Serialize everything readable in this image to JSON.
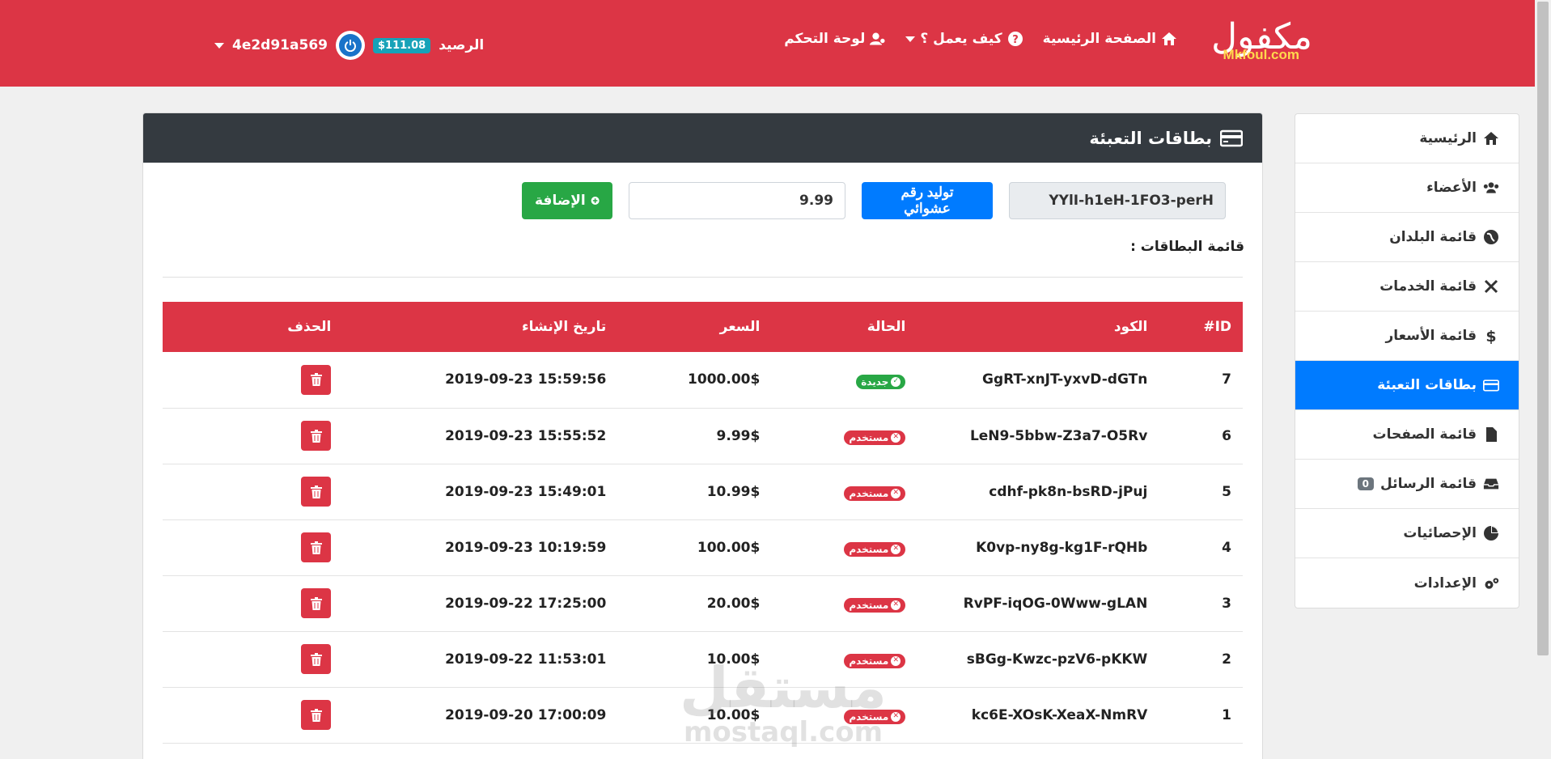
{
  "navbar": {
    "logo_ar": "مكفول",
    "logo_en": "Mkfoul.com",
    "links": {
      "home": "الصفحة الرئيسية",
      "how_it_works": "كيف يعمل ؟",
      "dashboard": "لوحة التحكم"
    },
    "balance_label": "الرصيد",
    "balance_value": "$111.08",
    "username": "4e2d91a569"
  },
  "sidebar": {
    "items": [
      {
        "label": "الرئيسية",
        "icon": "home-icon"
      },
      {
        "label": "الأعضاء",
        "icon": "users-icon"
      },
      {
        "label": "قائمة البلدان",
        "icon": "globe-icon"
      },
      {
        "label": "قائمة الخدمات",
        "icon": "tools-icon"
      },
      {
        "label": "قائمة الأسعار",
        "icon": "dollar-icon"
      },
      {
        "label": "بطاقات التعبئة",
        "icon": "credit-card-icon",
        "active": true
      },
      {
        "label": "قائمة الصفحات",
        "icon": "file-icon"
      },
      {
        "label": "قائمة الرسائل",
        "icon": "inbox-icon",
        "badge": "0"
      },
      {
        "label": "الإحصائيات",
        "icon": "pie-chart-icon"
      },
      {
        "label": "الإعدادات",
        "icon": "cogs-icon"
      }
    ]
  },
  "main": {
    "title": "بطاقات التعبئة",
    "code_value": "YYlI-h1eH-1FO3-perH",
    "generate_label": "توليد رقم عشوائي",
    "price_value": "9.99",
    "add_label": "الإضافة",
    "list_title": "قائمة البطاقات :"
  },
  "table": {
    "headers": {
      "id": "ID#",
      "code": "الكود",
      "status": "الحالة",
      "price": "السعر",
      "date": "تاريخ الإنشاء",
      "delete": "الحذف"
    },
    "rows": [
      {
        "id": "7",
        "code": "GgRT-xnJT-yxvD-dGTn",
        "status": "جديدة",
        "type": "new",
        "price": "1000.00$",
        "date": "2019-09-23 15:59:56"
      },
      {
        "id": "6",
        "code": "LeN9-5bbw-Z3a7-O5Rv",
        "status": "مستخدم",
        "type": "used",
        "price": "9.99$",
        "date": "2019-09-23 15:55:52"
      },
      {
        "id": "5",
        "code": "cdhf-pk8n-bsRD-jPuj",
        "status": "مستخدم",
        "type": "used",
        "price": "10.99$",
        "date": "2019-09-23 15:49:01"
      },
      {
        "id": "4",
        "code": "K0vp-ny8g-kg1F-rQHb",
        "status": "مستخدم",
        "type": "used",
        "price": "100.00$",
        "date": "2019-09-23 10:19:59"
      },
      {
        "id": "3",
        "code": "RvPF-iqOG-0Www-gLAN",
        "status": "مستخدم",
        "type": "used",
        "price": "20.00$",
        "date": "2019-09-22 17:25:00"
      },
      {
        "id": "2",
        "code": "sBGg-Kwzc-pzV6-pKKW",
        "status": "مستخدم",
        "type": "used",
        "price": "10.00$",
        "date": "2019-09-22 11:53:01"
      },
      {
        "id": "1",
        "code": "kc6E-XOsK-XeaX-NmRV",
        "status": "مستخدم",
        "type": "used",
        "price": "10.00$",
        "date": "2019-09-20 17:00:09"
      }
    ]
  },
  "watermark": {
    "ar": "مستقل",
    "en": "mostaql.com"
  },
  "colors": {
    "navbar": "#dc3545",
    "active": "#007bff",
    "success": "#28a745",
    "header_dark": "#343a40"
  }
}
